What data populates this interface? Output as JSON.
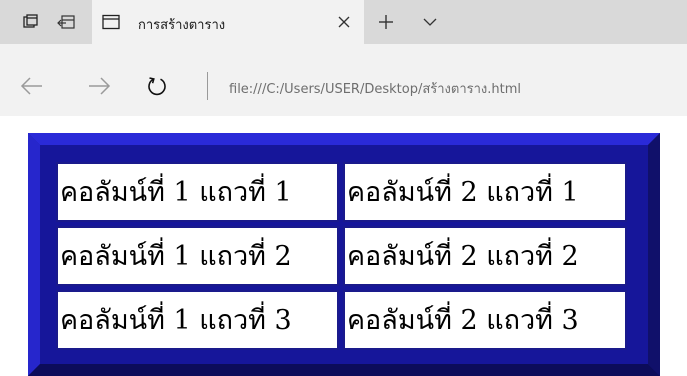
{
  "browser": {
    "tab": {
      "title": "การสร้างตาราง"
    },
    "address": {
      "url": "file:///C:/Users/USER/Desktop/สร้างตาราง.html"
    },
    "icons": {
      "tabs_aside": "tabs-aside-icon",
      "set_aside": "set-aside-icon",
      "page": "page-icon",
      "close": "close-icon",
      "new_tab": "plus-icon",
      "tab_list": "chevron-down-icon",
      "back": "back-arrow-icon",
      "forward": "forward-arrow-icon",
      "refresh": "refresh-icon"
    }
  },
  "page": {
    "table_colors": {
      "border": "#16169a",
      "cell_border": "#1a1a8c",
      "cell_background": "#ffffff"
    },
    "table": {
      "rows": [
        [
          "คอลัมน์ที่ 1 แถวที่ 1",
          "คอลัมน์ที่ 2 แถวที่ 1"
        ],
        [
          "คอลัมน์ที่ 1 แถวที่ 2",
          "คอลัมน์ที่ 2 แถวที่ 2"
        ],
        [
          "คอลัมน์ที่ 1 แถวที่ 3",
          "คอลัมน์ที่ 2 แถวที่ 3"
        ]
      ]
    }
  }
}
